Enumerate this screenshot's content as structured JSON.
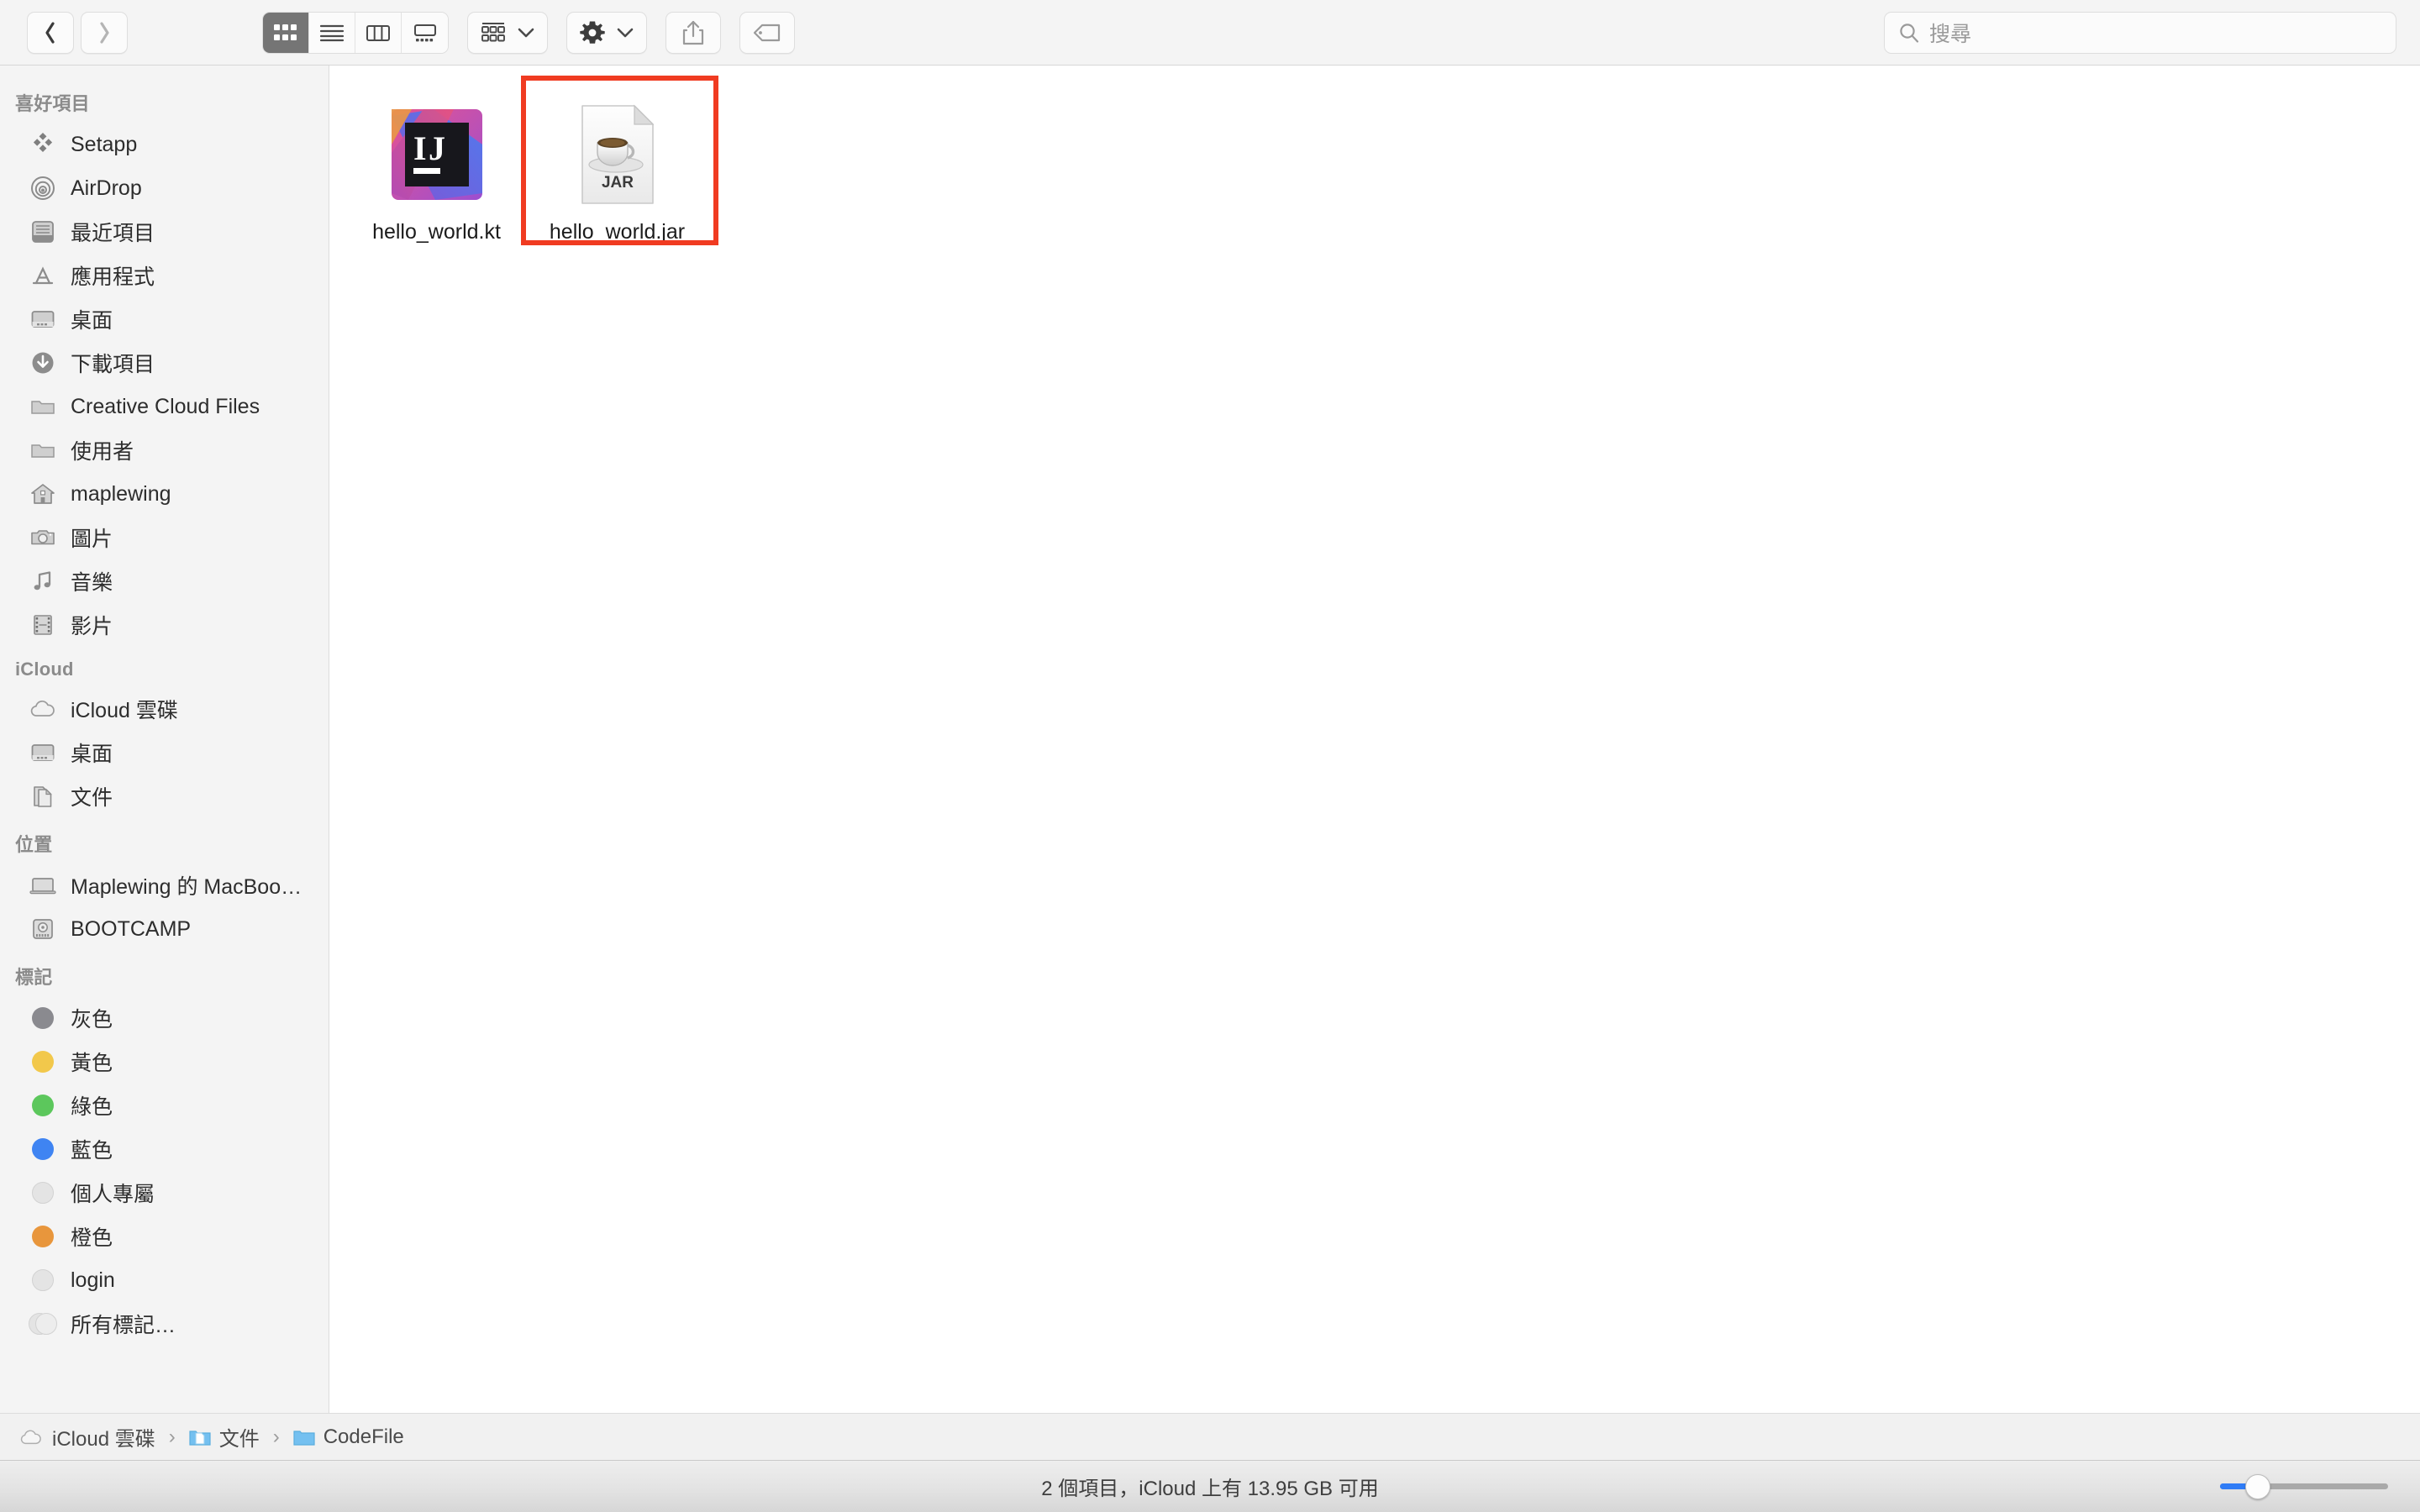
{
  "toolbar": {
    "back_label": "返回",
    "forward_label": "前進",
    "view_modes": [
      {
        "name": "icon-view",
        "label": "圖像顯示方式",
        "active": true
      },
      {
        "name": "list-view",
        "label": "列表顯示方式",
        "active": false
      },
      {
        "name": "column-view",
        "label": "直欄顯示方式",
        "active": false
      },
      {
        "name": "gallery-view",
        "label": "圖庫顯示方式",
        "active": false
      }
    ],
    "group_label": "分組方式",
    "action_label": "操作",
    "share_label": "分享",
    "tag_label": "標記"
  },
  "search": {
    "placeholder": "搜尋",
    "value": ""
  },
  "sidebar": {
    "sections": [
      {
        "title": "喜好項目",
        "items": [
          {
            "label": "Setapp",
            "icon": "setapp-icon"
          },
          {
            "label": "AirDrop",
            "icon": "airdrop-icon"
          },
          {
            "label": "最近項目",
            "icon": "recents-icon"
          },
          {
            "label": "應用程式",
            "icon": "applications-icon"
          },
          {
            "label": "桌面",
            "icon": "desktop-icon"
          },
          {
            "label": "下載項目",
            "icon": "downloads-icon"
          },
          {
            "label": "Creative Cloud Files",
            "icon": "folder-icon"
          },
          {
            "label": "使用者",
            "icon": "folder-icon"
          },
          {
            "label": "maplewing",
            "icon": "home-icon"
          },
          {
            "label": "圖片",
            "icon": "pictures-icon"
          },
          {
            "label": "音樂",
            "icon": "music-icon"
          },
          {
            "label": "影片",
            "icon": "movies-icon"
          }
        ]
      },
      {
        "title": "iCloud",
        "items": [
          {
            "label": "iCloud 雲碟",
            "icon": "icloud-icon"
          },
          {
            "label": "桌面",
            "icon": "desktop-icon"
          },
          {
            "label": "文件",
            "icon": "documents-icon"
          }
        ]
      },
      {
        "title": "位置",
        "items": [
          {
            "label": "Maplewing 的 MacBoo…",
            "icon": "laptop-icon"
          },
          {
            "label": "BOOTCAMP",
            "icon": "harddisk-icon"
          }
        ]
      },
      {
        "title": "標記",
        "items": [
          {
            "label": "灰色",
            "icon": "tag-dot",
            "color": "#8a8a8f"
          },
          {
            "label": "黃色",
            "icon": "tag-dot",
            "color": "#f2c council"
          },
          {
            "label": "綠色",
            "icon": "tag-dot",
            "color": "#5cc75c"
          },
          {
            "label": "藍色",
            "icon": "tag-dot",
            "color": "#3f84f2"
          },
          {
            "label": "個人專屬",
            "icon": "tag-dot",
            "color": "#e6e6e6"
          },
          {
            "label": "橙色",
            "icon": "tag-dot",
            "color": "#e8963c"
          },
          {
            "label": "login",
            "icon": "tag-dot",
            "color": "#e6e6e6"
          },
          {
            "label": "所有標記…",
            "icon": "tag-dot-multi",
            "color": "#e6e6e6"
          }
        ]
      }
    ]
  },
  "content": {
    "files": [
      {
        "name": "hello_world.kt",
        "icon": "intellij-kotlin-file-icon",
        "selected": false
      },
      {
        "name": "hello_world.jar",
        "icon": "jar-file-icon",
        "badge": "JAR",
        "selected": false,
        "annotated": true
      }
    ]
  },
  "pathbar": {
    "crumbs": [
      {
        "label": "iCloud 雲碟",
        "icon": "icloud-icon"
      },
      {
        "label": "文件",
        "icon": "documents-folder-icon"
      },
      {
        "label": "CodeFile",
        "icon": "folder-icon"
      }
    ],
    "separator": "›"
  },
  "statusbar": {
    "text": "2 個項目，iCloud 上有 13.95 GB 可用",
    "zoom_percent": 20
  },
  "colors": {
    "annotation": "#f03b21",
    "accent": "#2f7cf6",
    "sidebar_bg": "#f4f4f4",
    "content_bg": "#ffffff"
  }
}
